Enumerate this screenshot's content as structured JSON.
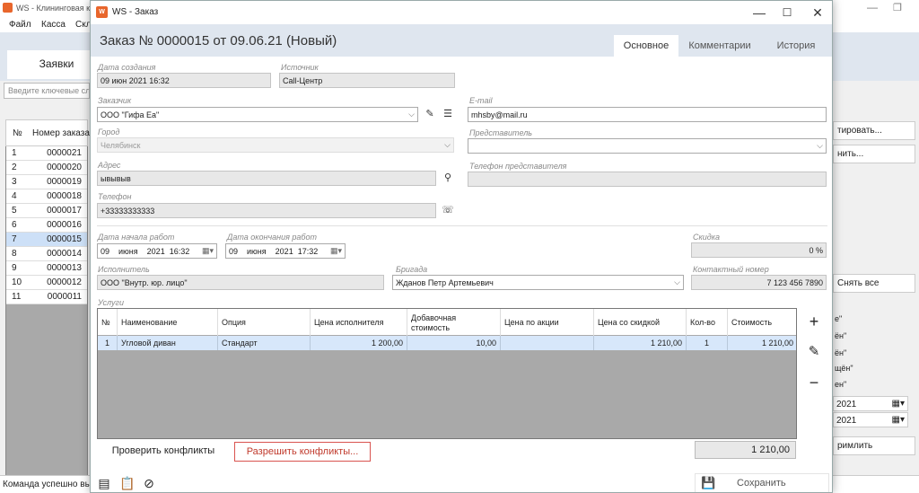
{
  "bg": {
    "title": "WS - Клининговая к",
    "menu": [
      "Файл",
      "Касса",
      "Скл"
    ],
    "tab_orders": "Заявки",
    "search_placeholder": "Введите ключевые сл",
    "grid_headers": [
      "№",
      "Номер заказа"
    ],
    "rows": [
      {
        "n": "1",
        "v": "0000021"
      },
      {
        "n": "2",
        "v": "0000020"
      },
      {
        "n": "3",
        "v": "0000019"
      },
      {
        "n": "4",
        "v": "0000018"
      },
      {
        "n": "5",
        "v": "0000017"
      },
      {
        "n": "6",
        "v": "0000016"
      },
      {
        "n": "7",
        "v": "0000015"
      },
      {
        "n": "8",
        "v": "0000014"
      },
      {
        "n": "9",
        "v": "0000013"
      },
      {
        "n": "10",
        "v": "0000012"
      },
      {
        "n": "11",
        "v": "0000011"
      }
    ],
    "status": "Команда успешно вып",
    "right_btn1": "тировать...",
    "right_btn2": "нить...",
    "right_btn3": "Снять все",
    "right_texts": [
      "е\"",
      "ён\"",
      "ён\"",
      "щён\"",
      "ен\""
    ],
    "right_date1": "2021",
    "right_date2": "2021",
    "right_btn4": "римлить"
  },
  "dialog": {
    "window_title": "WS - Заказ",
    "heading": "Заказ № 0000015 от 09.06.21 (Новый)",
    "tabs": [
      "Основное",
      "Комментарии",
      "История"
    ],
    "labels": {
      "created": "Дата создания",
      "source": "Источник",
      "customer": "Заказчик",
      "email": "E-mail",
      "city": "Город",
      "representative": "Представитель",
      "address": "Адрес",
      "rep_phone": "Телефон представителя",
      "phone": "Телефон",
      "start": "Дата начала работ",
      "end": "Дата окончания работ",
      "discount": "Скидка",
      "executor": "Исполнитель",
      "brigade": "Бригада",
      "contact": "Контактный номер",
      "services": "Услуги"
    },
    "values": {
      "created": "09 июн 2021 16:32",
      "source": "Call-Центр",
      "customer": "ООО \"Гифа Еа\"",
      "email": "mhsby@mail.ru",
      "city": "Челябинск",
      "representative": "",
      "address": "ывывыв",
      "rep_phone": "",
      "phone": "+33333333333",
      "start_day": "09",
      "start_month": "июня",
      "start_year": "2021",
      "start_time": "16:32",
      "end_day": "09",
      "end_month": "июня",
      "end_year": "2021",
      "end_time": "17:32",
      "discount": "0 %",
      "executor": "ООО \"Внутр. юр. лицо\"",
      "brigade": "Жданов Петр Артемьевич",
      "contact": "7 123 456 7890"
    },
    "table": {
      "headers": [
        "№",
        "Наименование",
        "Опция",
        "Цена исполнителя",
        "Добавочная стоимость",
        "Цена по акции",
        "Цена со скидкой",
        "Кол-во",
        "Стоимость"
      ],
      "rows": [
        [
          "1",
          "Угловой диван",
          "Стандарт",
          "1 200,00",
          "10,00",
          "",
          "1 210,00",
          "1",
          "1 210,00"
        ]
      ]
    },
    "buttons": {
      "check": "Проверить конфликты",
      "resolve": "Разрешить конфликты...",
      "save": "Сохранить"
    },
    "total": "1 210,00",
    "colors": {
      "header_bg": "#dfe6ef",
      "resolve_border": "#d9534f",
      "selected_row": "#d7e7fa",
      "app_icon": "#e8662c"
    }
  }
}
